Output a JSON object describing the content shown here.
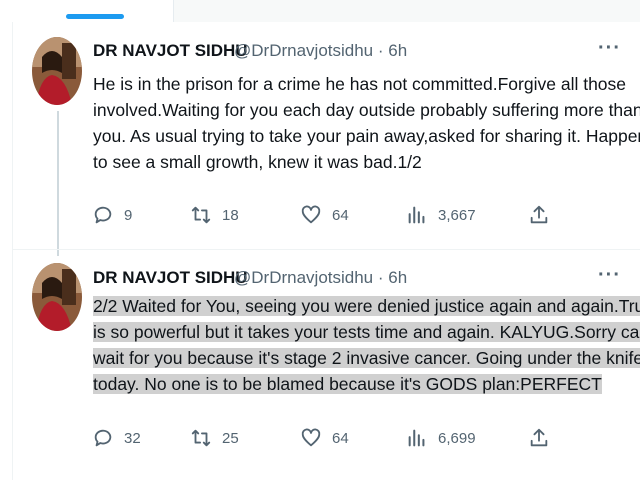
{
  "tweets": [
    {
      "author_name": "DR NAVJOT SIDHU",
      "handle_time": "@DrDrnavjotsidhu · 6h",
      "more_label": "···",
      "body_lines": [
        "He is in the prison for a crime he has not committed.Forgive all those",
        "involved.Waiting for you each day outside probably suffering more than",
        "you. As usual trying to take your pain away,asked for sharing it. Happened",
        "to see a small growth, knew it was bad.1/2"
      ],
      "replies": "9",
      "retweets": "18",
      "likes": "64",
      "views": "3,667"
    },
    {
      "author_name": "DR NAVJOT SIDHU",
      "handle_time": "@DrDrnavjotsidhu · 6h",
      "more_label": "···",
      "body_lines": [
        "2/2 Waited for You, seeing you were denied justice again and again.Truth",
        "is so powerful but it takes your tests time and again. KALYUG.Sorry can't",
        "wait for you because it's stage 2 invasive cancer. Going under the knife",
        "today. No one is to be blamed because it's GODS plan:PERFECT"
      ],
      "replies": "32",
      "retweets": "25",
      "likes": "64",
      "views": "6,699"
    }
  ],
  "icons": {
    "reply": "reply-icon",
    "retweet": "retweet-icon",
    "like": "heart-icon",
    "views": "views-icon",
    "share": "share-icon"
  },
  "colors": {
    "accent": "#1d9bf0",
    "text": "#0f1419",
    "muted": "#536471",
    "highlight": "#d0d0d0"
  }
}
